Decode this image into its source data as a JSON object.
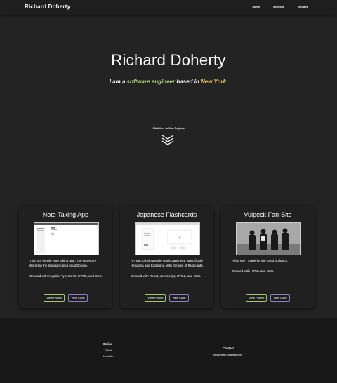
{
  "nav": {
    "brand": "Richard Doherty",
    "links": [
      "home",
      "projects",
      "contact"
    ]
  },
  "hero": {
    "title": "Richard Doherty",
    "sub_prefix": "I am a",
    "sub_role": "software engineer",
    "sub_mid": "based in",
    "sub_city": "New York."
  },
  "cta": {
    "label": "Click Here to View Projects"
  },
  "projects": [
    {
      "title": "Note Taking App",
      "description": "This is a simple note taking app. The notes are stored in the browser using localStorage.\n\nCreated with Angular, TypeScript, HTML, and CSS.",
      "view_project": "View Project",
      "view_code": "View Code"
    },
    {
      "title": "Japanese Flashcards",
      "description": "An app to help people study Japanese, specifically Hiragana and Katakana, with the use of flashcards.\n\nCreated with React, JavaScript, HTML, and CSS.",
      "view_project": "View Project",
      "view_code": "View Code"
    },
    {
      "title": "Vulpeck Fan-Site",
      "description": "A fan site I made for the band Vulfpeck.\n\nCreated with HTML and CSS.",
      "view_project": "View Project",
      "view_code": "View Code"
    }
  ],
  "footer": {
    "online_heading": "Online",
    "online_links": [
      "Github",
      "LinkedIn"
    ],
    "contact_heading": "Contact",
    "email": "rdohcherty7@gmail.com"
  },
  "colors": {
    "accent_green": "#b3e07a",
    "accent_yellow": "#f5c65e",
    "button_green": "#9ccc65",
    "button_purple": "#8b7fd0"
  }
}
